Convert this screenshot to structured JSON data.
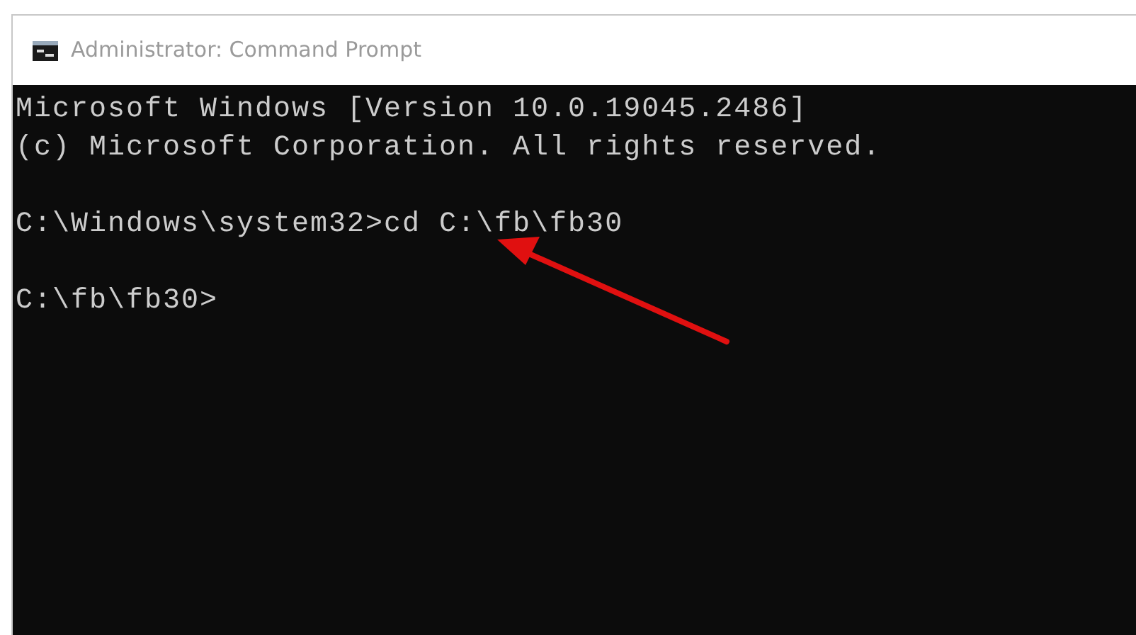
{
  "window": {
    "title": "Administrator: Command Prompt"
  },
  "console": {
    "blocks": [
      {
        "lines": [
          "Microsoft Windows [Version 10.0.19045.2486]",
          "(c) Microsoft Corporation. All rights reserved."
        ]
      },
      {
        "lines": [
          "C:\\Windows\\system32>cd C:\\fb\\fb30"
        ]
      },
      {
        "lines": [
          "C:\\fb\\fb30>"
        ]
      }
    ]
  }
}
